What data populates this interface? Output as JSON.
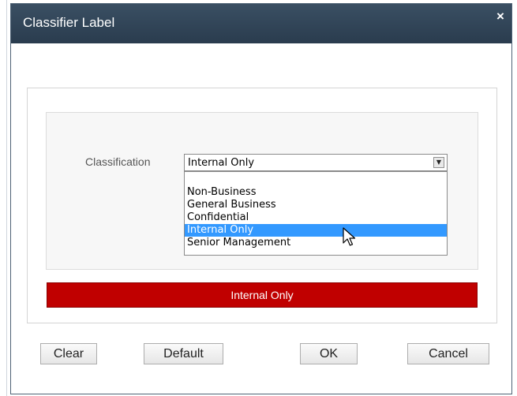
{
  "dialog": {
    "title": "Classifier Label",
    "close_label": "×"
  },
  "classification": {
    "label": "Classification",
    "selected_value": "Internal Only",
    "options": [
      "Non-Business",
      "General Business",
      "Confidential",
      "Internal Only",
      "Senior Management"
    ],
    "highlighted_option": "Internal Only"
  },
  "banner": {
    "text": "Internal Only",
    "color": "#c00000"
  },
  "buttons": {
    "clear": "Clear",
    "default": "Default",
    "ok": "OK",
    "cancel": "Cancel"
  },
  "icons": {
    "dropdown": "chevron-down-icon",
    "close": "close-icon",
    "pointer": "mouse-pointer-icon"
  }
}
